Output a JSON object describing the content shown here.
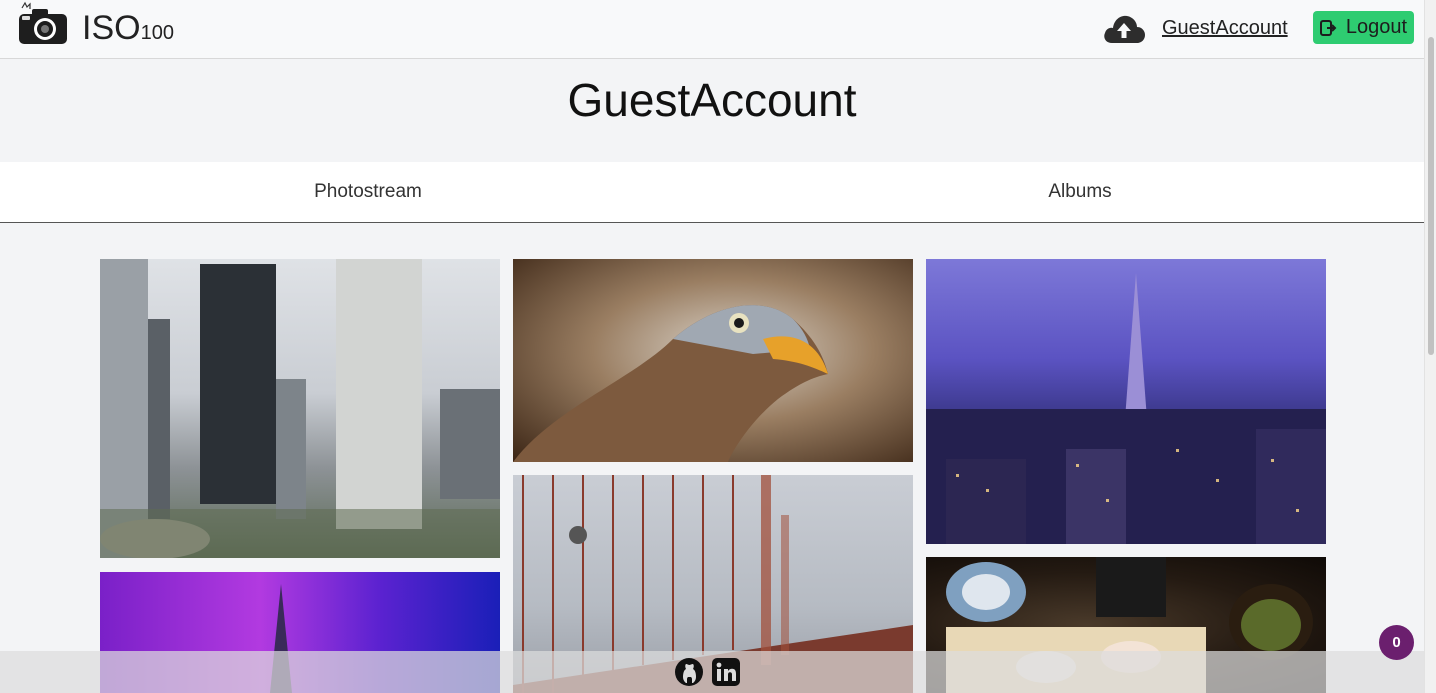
{
  "navbar": {
    "brand": "ISO",
    "brand_suffix": "100",
    "user_link": "GuestAccount",
    "logout_label": "Logout",
    "icons": [
      "camera-logo-icon",
      "upload-cloud-icon",
      "sign-out-icon"
    ]
  },
  "profile": {
    "title": "GuestAccount"
  },
  "tabs": [
    {
      "label": "Photostream"
    },
    {
      "label": "Albums"
    }
  ],
  "photos": [
    {
      "subject": "city skyscrapers"
    },
    {
      "subject": "eagle head"
    },
    {
      "subject": "city skyline at dusk"
    },
    {
      "subject": "tower against purple sky"
    },
    {
      "subject": "bridge in fog"
    },
    {
      "subject": "sushi platter"
    }
  ],
  "footer": {
    "icons": [
      "github-icon",
      "linkedin-icon"
    ]
  },
  "notification_badge": {
    "count": "0"
  },
  "colors": {
    "logout_button": "#2ecc71",
    "badge": "#6b1f6e"
  }
}
